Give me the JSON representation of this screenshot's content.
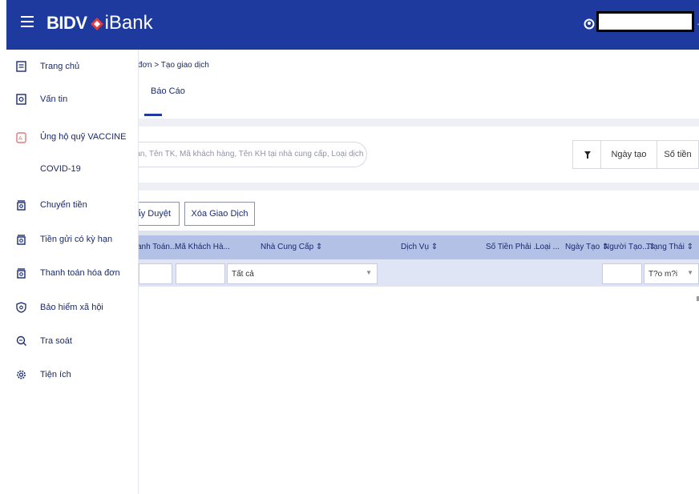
{
  "header": {
    "logo_bidv": "BIDV",
    "logo_ibank": "iBank",
    "brand_color": "#1f3a9e"
  },
  "sidebar": {
    "items": [
      {
        "label": "Trang chủ",
        "icon": "home-icon"
      },
      {
        "label": "Vấn tin",
        "icon": "inquiry-icon"
      },
      {
        "label": "Ủng hộ quỹ VACCINE",
        "label2": "COVID-19",
        "icon": "vaccine-icon"
      },
      {
        "label": "Chuyển tiền",
        "icon": "transfer-icon"
      },
      {
        "label": "Tiền gửi có kỳ hạn",
        "icon": "deposit-icon"
      },
      {
        "label": "Thanh toán hóa đơn",
        "icon": "bill-payment-icon"
      },
      {
        "label": "Bảo hiểm xã hội",
        "icon": "insurance-icon"
      },
      {
        "label": "Tra soát",
        "icon": "search-icon"
      },
      {
        "label": "Tiện ích",
        "icon": "gear-icon"
      }
    ]
  },
  "main": {
    "breadcrumb": "óa đơn > Tạo giao dịch",
    "tab_report": "Báo Cáo",
    "search_placeholder": "toán, Tên TK, Mã khách hàng, Tên KH tại nhà cung cấp, Loại dịch",
    "date_button": "Ngày tạo",
    "amount_button": "Số tiền",
    "push_button": "Đẩy Duyệt",
    "delete_button": "Xóa Giao Dịch",
    "columns": [
      "anh Toán...",
      "Mã Khách Hà...",
      "Nhà Cung Cấp ⇕",
      "Dịch Vụ ⇕",
      "Số Tiền Phải ...",
      "Loại ...",
      "Ngày Tạo ⇕",
      "Người Tạo...⇕",
      "Trạng Thái ⇕"
    ],
    "provider_filter": "Tất cả",
    "status_filter": "T?o m?i"
  }
}
